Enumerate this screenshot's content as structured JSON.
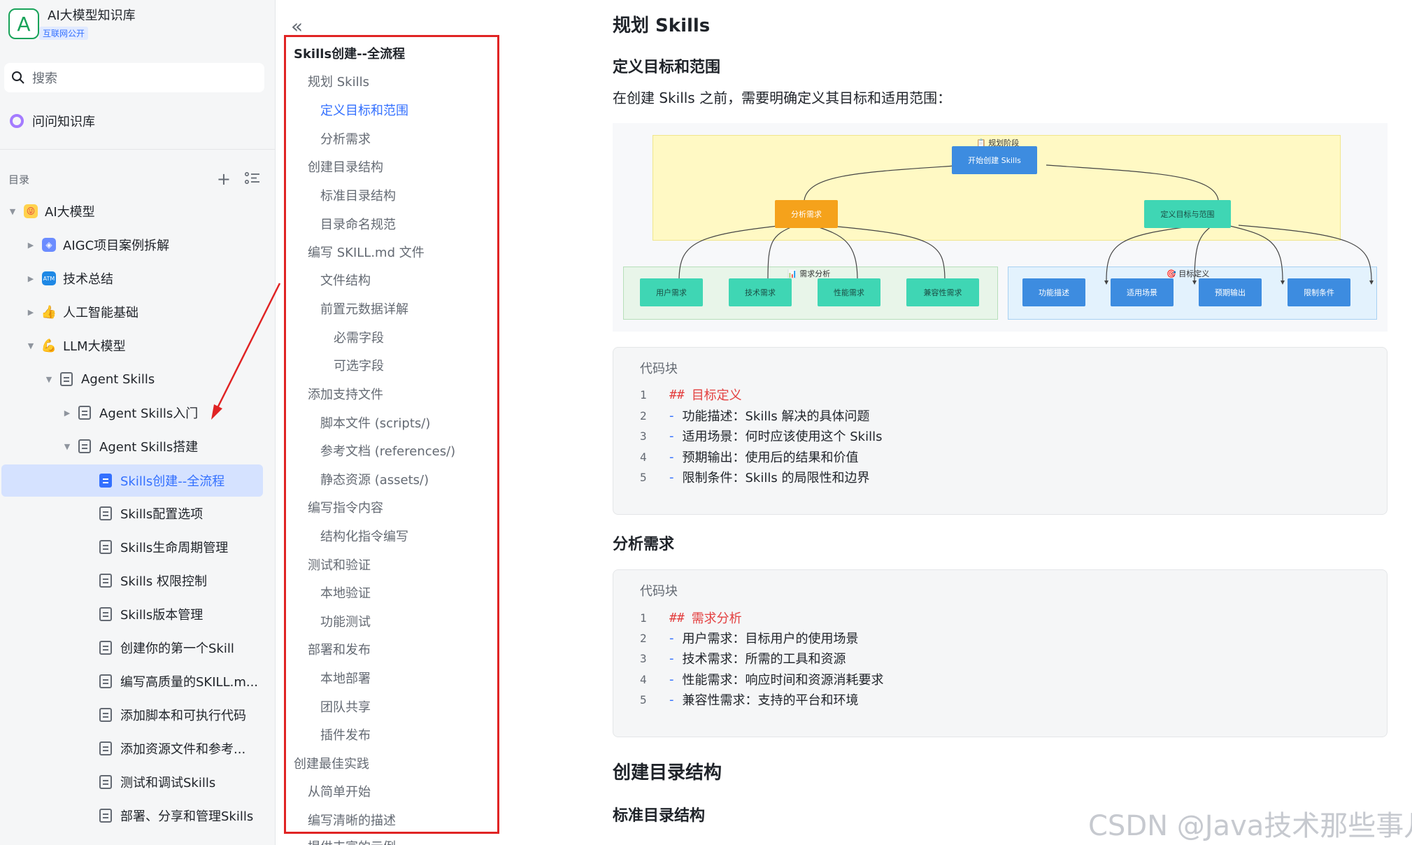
{
  "kb": {
    "logo_letter": "A",
    "title": "AI大模型知识库",
    "badge": "互联网公开"
  },
  "search": {
    "label": "搜索"
  },
  "ask": {
    "label": "问问知识库"
  },
  "toc": {
    "label": "目录",
    "add_icon": "plus-icon",
    "list_icon": "list-icon"
  },
  "tree": [
    {
      "label": "AI大模型"
    },
    {
      "label": "AIGC项目案例拆解"
    },
    {
      "label": "技术总结"
    },
    {
      "label": "人工智能基础"
    },
    {
      "label": "LLM大模型"
    },
    {
      "label": "Agent Skills"
    },
    {
      "label": "Agent Skills入门"
    },
    {
      "label": "Agent Skills搭建"
    },
    {
      "label": "Skills创建--全流程"
    },
    {
      "label": "Skills配置选项"
    },
    {
      "label": "Skills生命周期管理"
    },
    {
      "label": "Skills 权限控制"
    },
    {
      "label": "Skills版本管理"
    },
    {
      "label": "创建你的第一个Skill"
    },
    {
      "label": "编写高质量的SKILL.m..."
    },
    {
      "label": "添加脚本和可执行代码"
    },
    {
      "label": "添加资源文件和参考..."
    },
    {
      "label": "测试和调试Skills"
    },
    {
      "label": "部署、分享和管理Skills"
    }
  ],
  "outline": [
    {
      "label": "Skills创建--全流程"
    },
    {
      "label": "规划 Skills"
    },
    {
      "label": "定义目标和范围"
    },
    {
      "label": "分析需求"
    },
    {
      "label": "创建目录结构"
    },
    {
      "label": "标准目录结构"
    },
    {
      "label": "目录命名规范"
    },
    {
      "label": "编写 SKILL.md 文件"
    },
    {
      "label": "文件结构"
    },
    {
      "label": "前置元数据详解"
    },
    {
      "label": "必需字段"
    },
    {
      "label": "可选字段"
    },
    {
      "label": "添加支持文件"
    },
    {
      "label": "脚本文件 (scripts/)"
    },
    {
      "label": "参考文档 (references/)"
    },
    {
      "label": "静态资源 (assets/)"
    },
    {
      "label": "编写指令内容"
    },
    {
      "label": "结构化指令编写"
    },
    {
      "label": "测试和验证"
    },
    {
      "label": "本地验证"
    },
    {
      "label": "功能测试"
    },
    {
      "label": "部署和发布"
    },
    {
      "label": "本地部署"
    },
    {
      "label": "团队共享"
    },
    {
      "label": "插件发布"
    },
    {
      "label": "创建最佳实践"
    },
    {
      "label": "从简单开始"
    },
    {
      "label": "编写清晰的描述"
    },
    {
      "label": "提供丰富的示例"
    }
  ],
  "doc": {
    "h_plan": "规划 Skills",
    "h_define": "定义目标和范围",
    "intro": "在创建 Skills 之前，需要明确定义其目标和适用范围：",
    "h_analyze": "分析需求",
    "h_dir": "创建目录结构",
    "h_std": "标准目录结构"
  },
  "diagram": {
    "zone_plan": "📋 规划阶段",
    "zone_req": "📊 需求分析",
    "zone_goal": "🎯 目标定义",
    "start": "开始创建 Skills",
    "analyze": "分析需求",
    "define": "定义目标与范围",
    "req_nodes": [
      "用户需求",
      "技术需求",
      "性能需求",
      "兼容性需求"
    ],
    "goal_nodes": [
      "功能描述",
      "适用场景",
      "预期输出",
      "限制条件"
    ],
    "colors": {
      "plan_zone": "#fff9c4",
      "req_zone": "#e8f5e9",
      "goal_zone": "#e3f2fd",
      "start": "#3d8ce0",
      "analyze": "#f5a21b",
      "leaf": "#3fd6b4"
    }
  },
  "code1": {
    "title": "代码块",
    "lines": [
      {
        "n": "1",
        "hash": "##",
        "text": "目标定义"
      },
      {
        "n": "2",
        "dash": "-",
        "text": "功能描述：Skills 解决的具体问题"
      },
      {
        "n": "3",
        "dash": "-",
        "text": "适用场景：何时应该使用这个 Skills"
      },
      {
        "n": "4",
        "dash": "-",
        "text": "预期输出：使用后的结果和价值"
      },
      {
        "n": "5",
        "dash": "-",
        "text": "限制条件：Skills 的局限性和边界"
      }
    ]
  },
  "code2": {
    "title": "代码块",
    "lines": [
      {
        "n": "1",
        "hash": "##",
        "text": "需求分析"
      },
      {
        "n": "2",
        "dash": "-",
        "text": "用户需求：目标用户的使用场景"
      },
      {
        "n": "3",
        "dash": "-",
        "text": "技术需求：所需的工具和资源"
      },
      {
        "n": "4",
        "dash": "-",
        "text": "性能需求：响应时间和资源消耗要求"
      },
      {
        "n": "5",
        "dash": "-",
        "text": "兼容性需求：支持的平台和环境"
      }
    ]
  },
  "watermark": "CSDN @Java技术那些事儿"
}
